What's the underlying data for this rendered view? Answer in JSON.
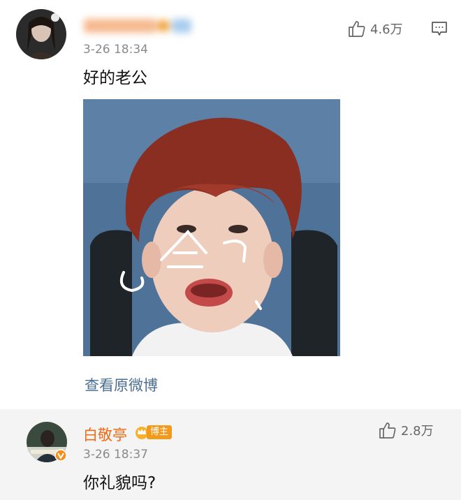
{
  "comments": [
    {
      "time": "3-26 18:34",
      "text": "好的老公",
      "likes": "4.6万",
      "view_original_link": "查看原微博",
      "meme_text": "哈"
    },
    {
      "author": "白敬亭",
      "badge": "博主",
      "time": "3-26 18:37",
      "text": "你礼貌吗?",
      "likes": "2.8万"
    }
  ],
  "colors": {
    "author_name": "#ef6a14",
    "link": "#4b6e93",
    "badge": "#f29a1c",
    "reply_background": "#f4f4f4"
  },
  "icons": [
    "thumbs-up-icon",
    "comment-icon",
    "crown-icon",
    "verified-icon"
  ]
}
